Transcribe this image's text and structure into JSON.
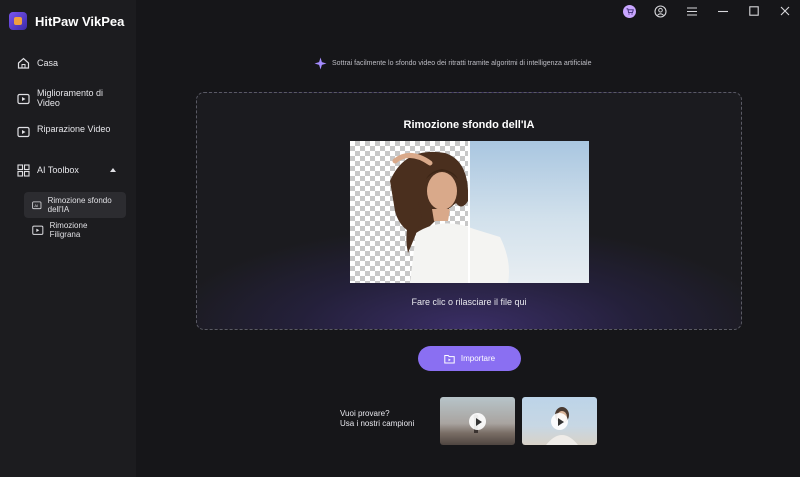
{
  "app": {
    "name": "HitPaw VikPea"
  },
  "sidebar": {
    "items": [
      {
        "label": "Casa"
      },
      {
        "label": "Miglioramento di Video"
      },
      {
        "label": "Riparazione Video"
      },
      {
        "label": "AI Toolbox"
      }
    ],
    "sub_items": [
      {
        "label": "Rimozione sfondo dell'IA",
        "active": true
      },
      {
        "label": "Rimozione Filigrana",
        "active": false
      }
    ]
  },
  "topbar": {
    "icons": [
      "cart-icon",
      "user-icon",
      "menu-icon",
      "minimize-icon",
      "maximize-icon",
      "close-icon"
    ]
  },
  "main": {
    "tagline": "Sottrai facilmente lo sfondo video dei ritratti tramite algoritmi di intelligenza artificiale",
    "dropzone_title": "Rimozione sfondo dell'IA",
    "dropzone_hint": "Fare clic o rilasciare il file qui",
    "import_label": "Importare",
    "samples_line1": "Vuoi provare?",
    "samples_line2": "Usa i nostri campioni"
  },
  "colors": {
    "accent": "#8a6ff2",
    "background": "#161619",
    "sidebar": "#1c1c1f"
  }
}
